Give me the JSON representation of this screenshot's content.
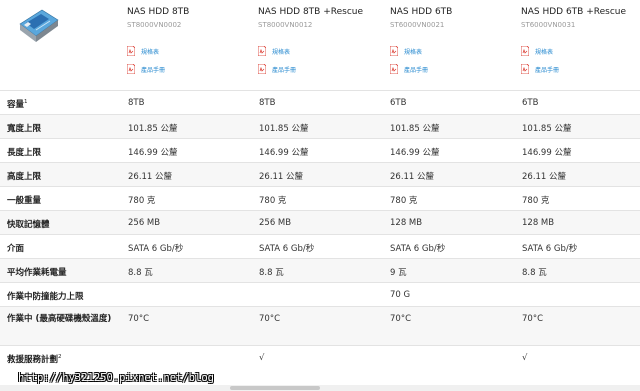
{
  "products": [
    {
      "name": "NAS HDD 8TB",
      "model": "ST8000VN0002",
      "doc1": "規格表",
      "doc2": "產品手冊"
    },
    {
      "name": "NAS HDD 8TB +Rescue",
      "model": "ST8000VN0012",
      "doc1": "規格表",
      "doc2": "產品手冊"
    },
    {
      "name": "NAS HDD 6TB",
      "model": "ST6000VN0021",
      "doc1": "規格表",
      "doc2": "產品手冊"
    },
    {
      "name": "NAS HDD 6TB +Rescue",
      "model": "ST6000VN0031",
      "doc1": "規格表",
      "doc2": "產品手冊"
    }
  ],
  "rows": [
    {
      "label": "容量",
      "sup": "1",
      "values": [
        "8TB",
        "8TB",
        "6TB",
        "6TB"
      ]
    },
    {
      "label": "寬度上限",
      "sup": "",
      "values": [
        "101.85 公釐",
        "101.85 公釐",
        "101.85 公釐",
        "101.85 公釐"
      ]
    },
    {
      "label": "長度上限",
      "sup": "",
      "values": [
        "146.99 公釐",
        "146.99 公釐",
        "146.99 公釐",
        "146.99 公釐"
      ]
    },
    {
      "label": "高度上限",
      "sup": "",
      "values": [
        "26.11 公釐",
        "26.11 公釐",
        "26.11 公釐",
        "26.11 公釐"
      ]
    },
    {
      "label": "一般重量",
      "sup": "",
      "values": [
        "780 克",
        "780 克",
        "780 克",
        "780 克"
      ]
    },
    {
      "label": "快取記憶體",
      "sup": "",
      "values": [
        "256 MB",
        "256 MB",
        "128 MB",
        "128 MB"
      ]
    },
    {
      "label": "介面",
      "sup": "",
      "values": [
        "SATA 6 Gb/秒",
        "SATA 6 Gb/秒",
        "SATA 6 Gb/秒",
        "SATA 6 Gb/秒"
      ]
    },
    {
      "label": "平均作業耗電量",
      "sup": "",
      "values": [
        "8.8 瓦",
        "8.8 瓦",
        "9 瓦",
        "8.8 瓦"
      ]
    },
    {
      "label": "作業中防撞能力上限",
      "sup": "",
      "values": [
        "",
        "",
        "70 G",
        ""
      ]
    },
    {
      "label": "作業中 (最高硬碟機殼溫度)",
      "sup": "",
      "values": [
        "70°C",
        "70°C",
        "70°C",
        "70°C"
      ]
    },
    {
      "label": "救援服務計劃",
      "sup": "2",
      "values": [
        "",
        "√",
        "",
        "√"
      ]
    }
  ],
  "watermark": "http://hy321250.pixnet.net/blog",
  "colors": {
    "link": "#2a8bd0",
    "pdf": "#d93025",
    "row_alt": "#f7f7f7",
    "border": "#e3e3e3"
  }
}
